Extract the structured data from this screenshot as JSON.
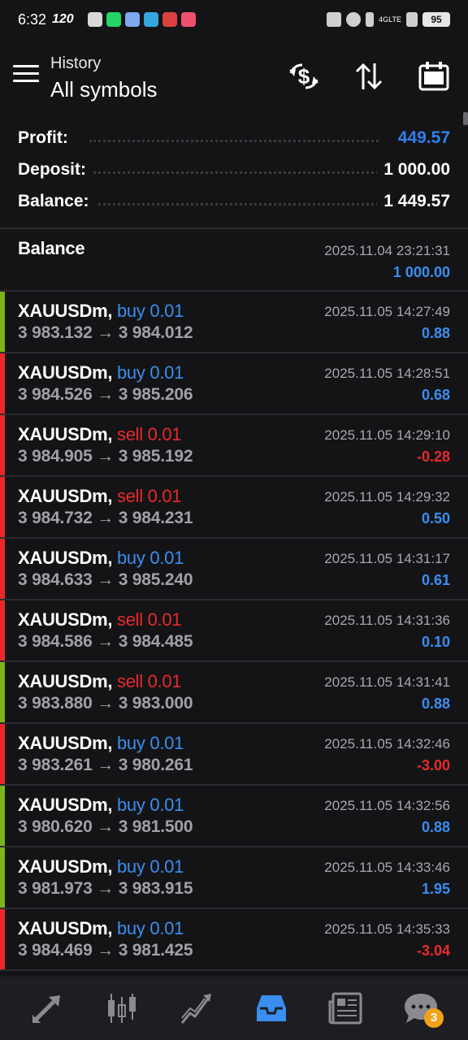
{
  "status_bar": {
    "time": "6:32",
    "refresh_rate": "120",
    "network": "4GLTE",
    "battery": "95"
  },
  "header": {
    "subtitle": "History",
    "title": "All symbols"
  },
  "summary": {
    "profit_label": "Profit:",
    "profit_value": "449.57",
    "deposit_label": "Deposit:",
    "deposit_value": "1 000.00",
    "balance_label": "Balance:",
    "balance_value": "1 449.57"
  },
  "balance_entry": {
    "label": "Balance",
    "time": "2025.11.04 23:21:31",
    "amount": "1 000.00"
  },
  "deals": [
    {
      "symbol": "XAUUSDm,",
      "side": "buy 0.01",
      "prices": "3 983.132 → 3 984.012",
      "time": "2025.11.05 14:27:49",
      "profit": "0.88"
    },
    {
      "symbol": "XAUUSDm,",
      "side": "buy 0.01",
      "prices": "3 984.526 → 3 985.206",
      "time": "2025.11.05 14:28:51",
      "profit": "0.68"
    },
    {
      "symbol": "XAUUSDm,",
      "side": "sell 0.01",
      "prices": "3 984.905 → 3 985.192",
      "time": "2025.11.05 14:29:10",
      "profit": "-0.28"
    },
    {
      "symbol": "XAUUSDm,",
      "side": "sell 0.01",
      "prices": "3 984.732 → 3 984.231",
      "time": "2025.11.05 14:29:32",
      "profit": "0.50"
    },
    {
      "symbol": "XAUUSDm,",
      "side": "buy 0.01",
      "prices": "3 984.633 → 3 985.240",
      "time": "2025.11.05 14:31:17",
      "profit": "0.61"
    },
    {
      "symbol": "XAUUSDm,",
      "side": "sell 0.01",
      "prices": "3 984.586 → 3 984.485",
      "time": "2025.11.05 14:31:36",
      "profit": "0.10"
    },
    {
      "symbol": "XAUUSDm,",
      "side": "sell 0.01",
      "prices": "3 983.880 → 3 983.000",
      "time": "2025.11.05 14:31:41",
      "profit": "0.88"
    },
    {
      "symbol": "XAUUSDm,",
      "side": "buy 0.01",
      "prices": "3 983.261 → 3 980.261",
      "time": "2025.11.05 14:32:46",
      "profit": "-3.00"
    },
    {
      "symbol": "XAUUSDm,",
      "side": "buy 0.01",
      "prices": "3 980.620 → 3 981.500",
      "time": "2025.11.05 14:32:56",
      "profit": "0.88"
    },
    {
      "symbol": "XAUUSDm,",
      "side": "buy 0.01",
      "prices": "3 981.973 → 3 983.915",
      "time": "2025.11.05 14:33:46",
      "profit": "1.95"
    },
    {
      "symbol": "XAUUSDm,",
      "side": "buy 0.01",
      "prices": "3 984.469 → 3 981.425",
      "time": "2025.11.05 14:35:33",
      "profit": "-3.04"
    }
  ],
  "bottom_nav": {
    "items": [
      "quotes-icon",
      "chart-icon",
      "trade-icon",
      "history-icon",
      "news-icon",
      "chat-icon"
    ],
    "active": "history-icon",
    "chat_badge": "3"
  },
  "colors": {
    "background": "#141416",
    "profit_blue": "#3a8ef0",
    "loss_red": "#e8292c",
    "marker_green": "#7cb518",
    "marker_red": "#e8292c"
  }
}
